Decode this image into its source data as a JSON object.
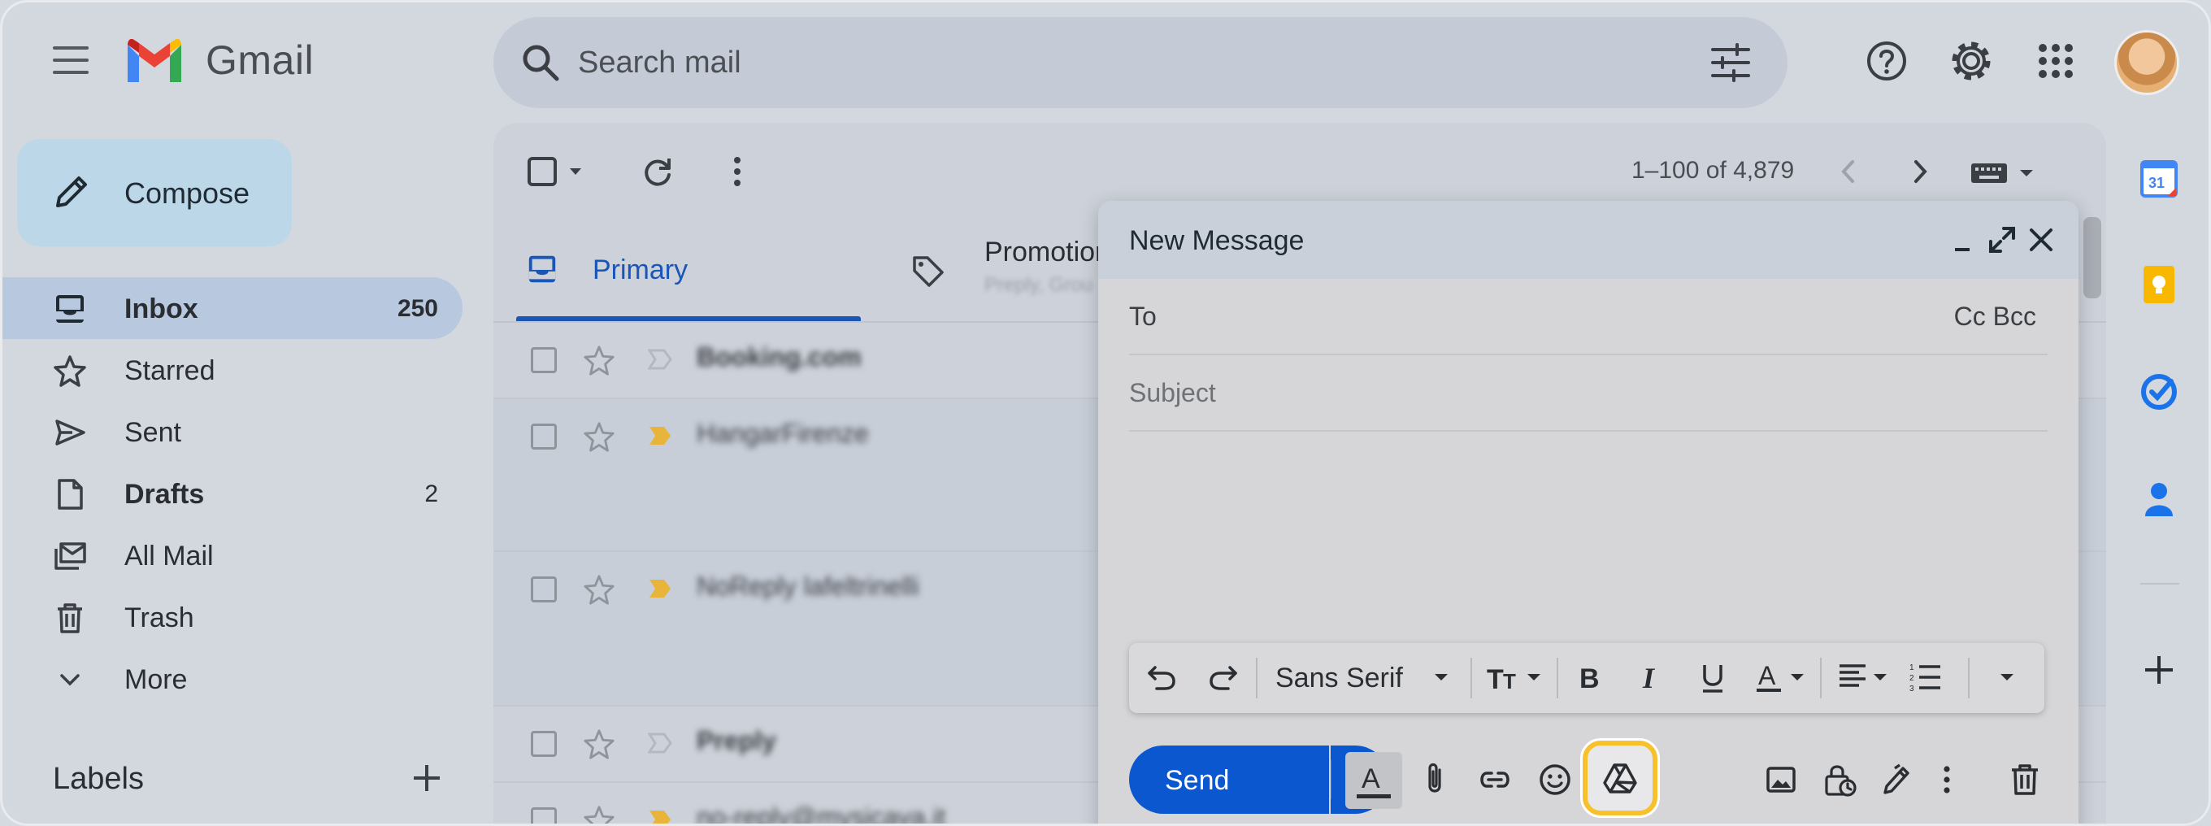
{
  "app": {
    "brand": "Gmail"
  },
  "search": {
    "placeholder": "Search mail"
  },
  "nav": {
    "compose_label": "Compose",
    "items": [
      {
        "label": "Inbox",
        "count": "250"
      },
      {
        "label": "Starred",
        "count": ""
      },
      {
        "label": "Sent",
        "count": ""
      },
      {
        "label": "Drafts",
        "count": "2"
      },
      {
        "label": "All Mail",
        "count": ""
      },
      {
        "label": "Trash",
        "count": ""
      },
      {
        "label": "More",
        "count": ""
      }
    ],
    "labels_header": "Labels"
  },
  "list": {
    "pager": "1–100 of 4,879",
    "tabs": [
      {
        "label": "Primary"
      },
      {
        "label": "Promotions",
        "snippet": "Preply, Grou"
      }
    ],
    "rows": [
      {
        "sender": "Booking.com"
      },
      {
        "sender": "HangarFirenze"
      },
      {
        "sender": "NoReply lafeltrinelli"
      },
      {
        "sender": "Preply"
      },
      {
        "sender": "no-reply@mysicava.it"
      }
    ]
  },
  "compose": {
    "title": "New Message",
    "to_label": "To",
    "cc_bcc": "Cc Bcc",
    "subject_placeholder": "Subject",
    "font_name": "Sans Serif",
    "send_label": "Send"
  },
  "colors": {
    "accent": "#0b57d0",
    "highlight": "#f6c12a"
  }
}
